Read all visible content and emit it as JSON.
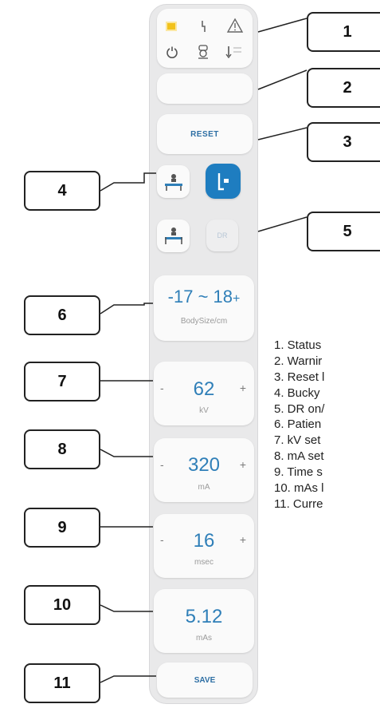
{
  "panel": {
    "status_icons": [
      "exposure-indicator-icon",
      "lightning-icon",
      "warning-triangle-icon",
      "power-icon",
      "tube-icon",
      "temperature-icon"
    ],
    "temperature_caption": "",
    "reset_label": "RESET",
    "dr_label": "DR",
    "body_size": {
      "minus": "-",
      "range": "17 ~ 18",
      "plus": "+",
      "unit": "BodySize/cm"
    },
    "kv": {
      "minus": "-",
      "value": "62",
      "plus": "+",
      "unit": "kV"
    },
    "ma": {
      "minus": "-",
      "value": "320",
      "plus": "+",
      "unit": "mA"
    },
    "msec": {
      "minus": "-",
      "value": "16",
      "plus": "+",
      "unit": "msec"
    },
    "mas": {
      "value": "5.12",
      "unit": "mAs"
    },
    "save_label": "SAVE"
  },
  "callouts": [
    "1",
    "2",
    "3",
    "4",
    "5",
    "6",
    "7",
    "8",
    "9",
    "10",
    "11"
  ],
  "legend": [
    "1. Status",
    "2. Warnir",
    "3. Reset l",
    "4. Bucky",
    "5. DR on/",
    "6. Patien",
    "7. kV set",
    "8. mA set",
    "9. Time s",
    "10. mAs l",
    "11. Curre"
  ],
  "colors": {
    "accent": "#1e7dc0",
    "value_text": "#2f7fb8",
    "indicator": "#f2c21b"
  }
}
